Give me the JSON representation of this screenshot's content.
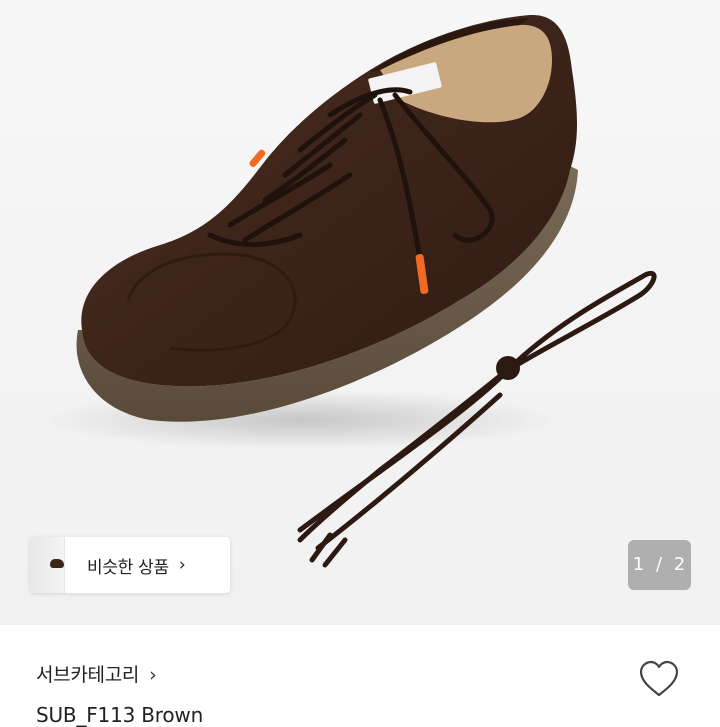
{
  "product_image": {
    "description_icon": "shoe-photo",
    "accent_colors": {
      "suede": "#3e2519",
      "sole": "#6b5a48",
      "aglet": "#f06a21"
    }
  },
  "similar_products": {
    "label": "비슷한 상품",
    "arrow": "›"
  },
  "pagination": {
    "current": "1",
    "separator": "/",
    "total": "2",
    "text": "1 / 2"
  },
  "listing": {
    "subcategory": "서브카테고리",
    "subcategory_chevron": "›",
    "title": "SUB_F113 Brown"
  },
  "actions": {
    "like_icon": "heart-outline-icon"
  }
}
